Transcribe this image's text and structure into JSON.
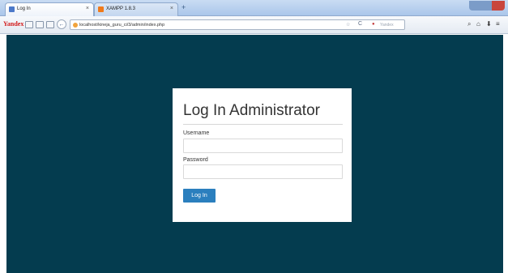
{
  "browser": {
    "tabs": [
      {
        "label": "Log In",
        "close_glyph": "×",
        "active": true
      },
      {
        "label": "XAMPP 1.8.3",
        "close_glyph": "×",
        "active": false
      }
    ],
    "new_tab_glyph": "+",
    "brand": "Yandex",
    "address_bar": {
      "url": "localhost/kineja_guru_ci/3/admin/index.php",
      "search_placeholder": "Yandex"
    },
    "icons": {
      "back": "←",
      "reload": "C",
      "star": "☆",
      "search": "⌕",
      "home": "⌂",
      "download": "⬇"
    }
  },
  "login": {
    "title": "Log In Administrator",
    "username_label": "Username",
    "username_value": "",
    "password_label": "Password",
    "password_value": "",
    "submit_label": "Log In"
  },
  "colors": {
    "page_background": "#043c4f",
    "panel_background": "#ffffff",
    "button_background": "#2b7fbe",
    "button_text": "#ffffff"
  }
}
